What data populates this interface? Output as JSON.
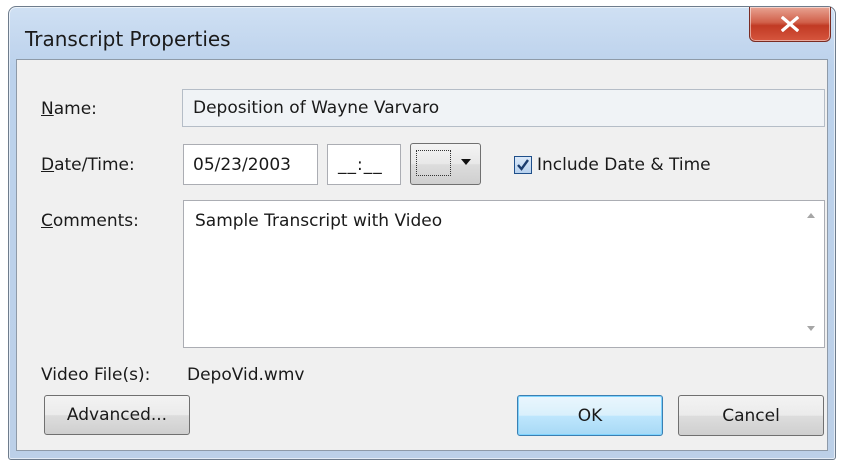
{
  "window": {
    "title": "Transcript Properties",
    "close_icon": "close-x-icon",
    "close_color": "#c13a24"
  },
  "form": {
    "name_label_u": "N",
    "name_label_rest": "ame:",
    "name_value": "Deposition of Wayne Varvaro",
    "date_label_u": "D",
    "date_label_rest": "ate/Time:",
    "date_value": "05/23/2003",
    "time_value": "__:__",
    "calendar_dropdown_icon": "chevron-down-icon",
    "include_checked": true,
    "include_label": "Include Date & Time",
    "comments_label_u": "C",
    "comments_label_rest": "omments:",
    "comments_value": "Sample Transcript with Video",
    "video_label": "Video File(s):",
    "video_value": "DepoVid.wmv"
  },
  "buttons": {
    "advanced_label": "Advanced...",
    "ok_label": "OK",
    "cancel_label": "Cancel",
    "ok_accent": "#3c7fb1"
  }
}
